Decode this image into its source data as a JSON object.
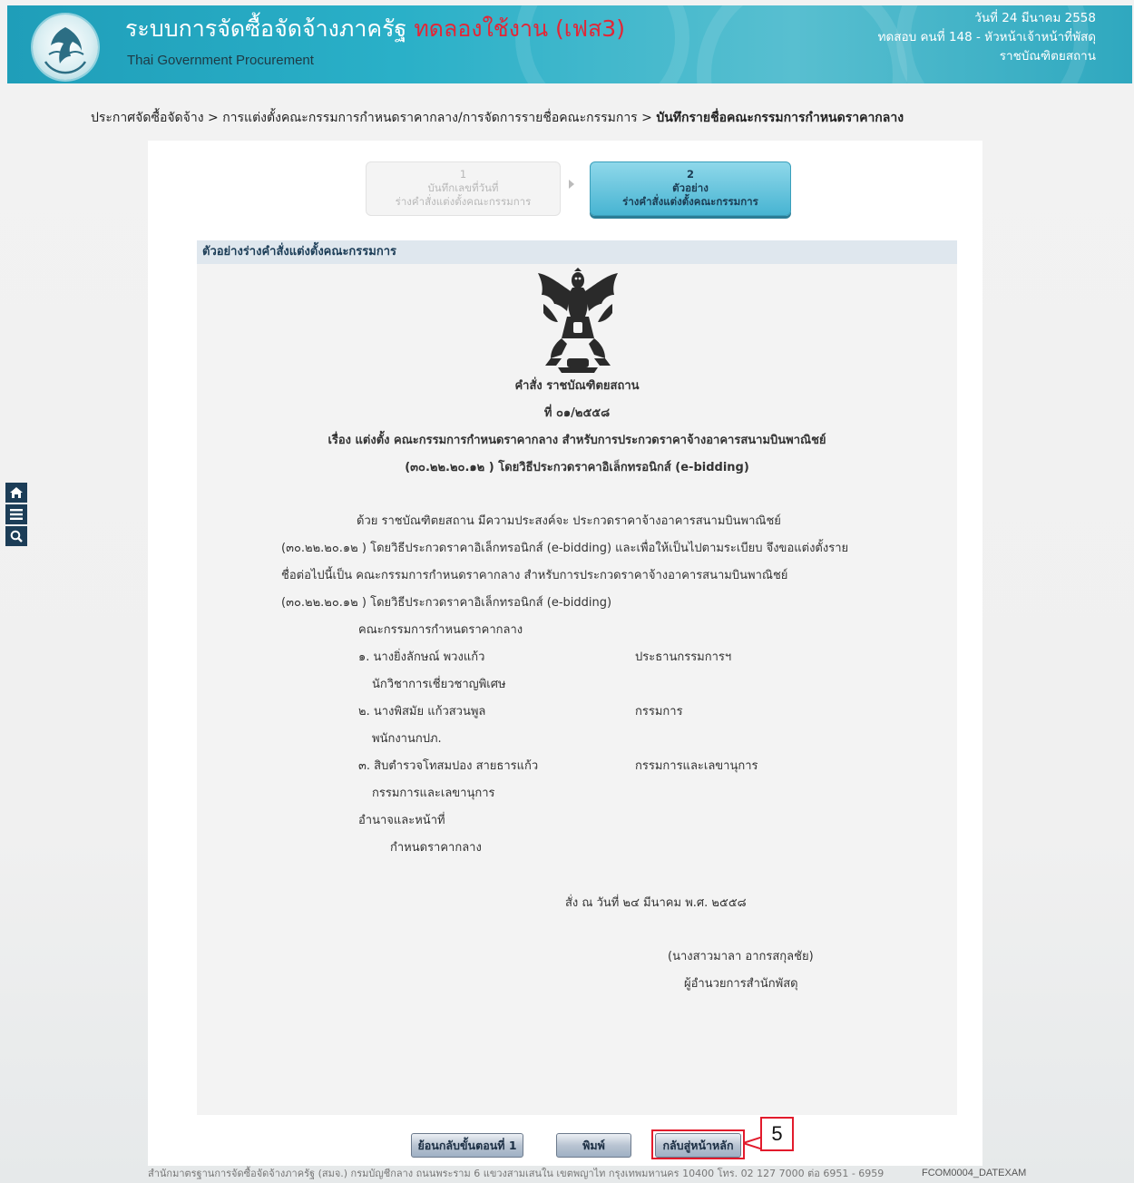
{
  "header": {
    "title": "ระบบการจัดซื้อจัดจ้างภาครัฐ",
    "trial_label": "ทดลองใช้งาน (เฟส3)",
    "subtitle": "Thai Government Procurement",
    "date": "วันที่ 24 มีนาคม 2558",
    "user": "ทดสอบ คนที่ 148 - หัวหน้าเจ้าหน้าที่พัสดุ",
    "org": "ราชบัณฑิตยสถาน"
  },
  "side_tools": [
    "home-icon",
    "menu-icon",
    "search-icon"
  ],
  "breadcrumb": {
    "item1": "ประกาศจัดซื้อจัดจ้าง",
    "sep": ">",
    "item2": "การแต่งตั้งคณะกรรมการกำหนดราคากลาง/การจัดการรายชื่อคณะกรรมการ",
    "current": "บันทึกรายชื่อคณะกรรมการกำหนดราคากลาง"
  },
  "wizard": {
    "step1": {
      "num": "1",
      "line1": "บันทึกเลขที่วันที่",
      "line2": "ร่างคำสั่งแต่งตั้งคณะกรรมการ"
    },
    "step2": {
      "num": "2",
      "line1": "ตัวอย่าง",
      "line2": "ร่างคำสั่งแต่งตั้งคณะกรรมการ"
    }
  },
  "panel_title": "ตัวอย่างร่างคำสั่งแต่งตั้งคณะกรรมการ",
  "doc": {
    "order_of": "คำสั่ง ราชบัณฑิตยสถาน",
    "number": "ที่ ๐๑/๒๕๕๘",
    "subject1": "เรื่อง แต่งตั้ง คณะกรรมการกำหนดราคากลาง สำหรับการประกวดราคาจ้างอาคารสนามบินพาณิชย์",
    "subject2": "(๓๐.๒๒.๒๐.๑๒ ) โดยวิธีประกวดราคาอิเล็กทรอนิกส์ (e-bidding)",
    "para1": "ด้วย ราชบัณฑิตยสถาน มีความประสงค์จะ ประกวดราคาจ้างอาคารสนามบินพาณิชย์",
    "para2": "(๓๐.๒๒.๒๐.๑๒ ) โดยวิธีประกวดราคาอิเล็กทรอนิกส์ (e-bidding)  และเพื่อให้เป็นไปตามระเบียบ จึงขอแต่งตั้งราย",
    "para3": "ชื่อต่อไปนี้เป็น คณะกรรมการกำหนดราคากลาง สำหรับการประกวดราคาจ้างอาคารสนามบินพาณิชย์",
    "para4": "(๓๐.๒๒.๒๐.๑๒ ) โดยวิธีประกวดราคาอิเล็กทรอนิกส์ (e-bidding)",
    "committee_heading": "คณะกรรมการกำหนดราคากลาง",
    "members": [
      {
        "name": "๑. นางยิ่งลักษณ์ พวงแก้ว",
        "position": "นักวิชาการเชี่ยวชาญพิเศษ",
        "role": "ประธานกรรมการฯ"
      },
      {
        "name": "๒. นางพิสมัย แก้วสวนพูล",
        "position": "พนักงานกปภ.",
        "role": "กรรมการ"
      },
      {
        "name": "๓. สิบตำรวจโทสมปอง สายธารแก้ว",
        "position": "กรรมการและเลขานุการ",
        "role": "กรรมการและเลขานุการ"
      }
    ],
    "duty_heading": "อำนาจและหน้าที่",
    "duty": "กำหนดราคากลาง",
    "order_date": "สั่ง ณ วันที่  ๒๔ มีนาคม พ.ศ. ๒๕๕๘",
    "signer": "(นางสาวมาลา อากรสกุลชัย)",
    "signer_title": "ผู้อำนวยการสำนักพัสดุ"
  },
  "buttons": {
    "back": "ย้อนกลับขั้นตอนที่ 1",
    "print": "พิมพ์",
    "home": "กลับสู่หน้าหลัก"
  },
  "annotation_number": "5",
  "footer": {
    "text": "สำนักมาตรฐานการจัดซื้อจัดจ้างภาครัฐ (สมจ.) กรมบัญชีกลาง ถนนพระราม 6 แขวงสามเสนใน เขตพญาไท กรุงเทพมหานคร 10400 โทร. 02 127 7000 ต่อ 6951 - 6959",
    "code": "FCOM0004_DATEXAM"
  }
}
